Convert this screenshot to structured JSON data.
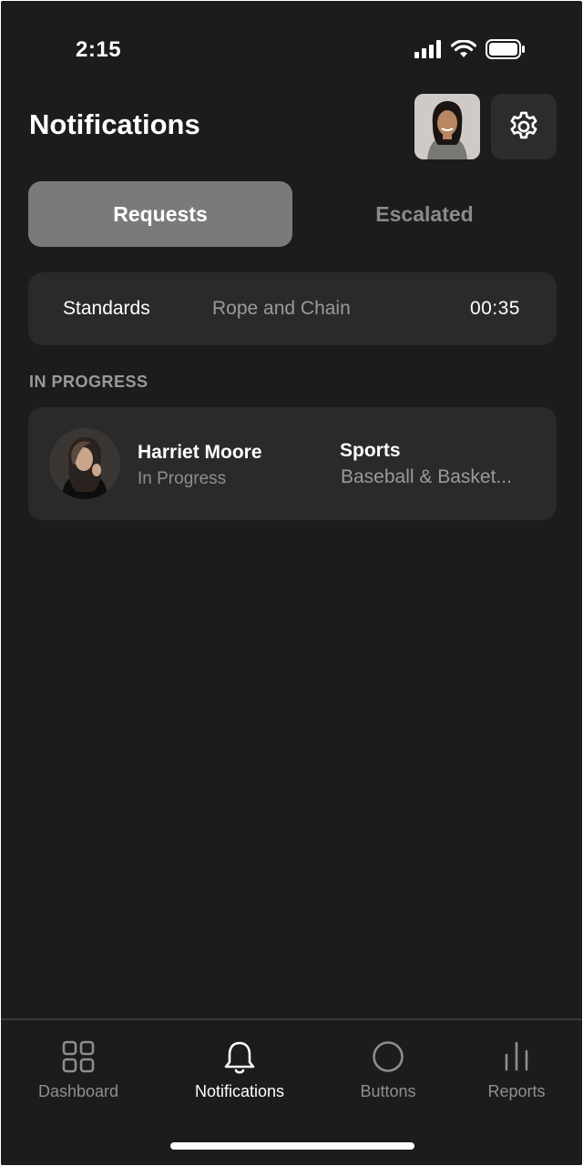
{
  "status_bar": {
    "time": "2:15"
  },
  "header": {
    "title": "Notifications"
  },
  "tabs": [
    {
      "label": "Requests",
      "active": true
    },
    {
      "label": "Escalated",
      "active": false
    }
  ],
  "filter": {
    "category": "Standards",
    "subcategory": "Rope and Chain",
    "timer": "00:35"
  },
  "section": {
    "label": "IN PROGRESS"
  },
  "requests": [
    {
      "name": "Harriet Moore",
      "status": "In Progress",
      "category": "Sports",
      "subcategory": "Baseball & Basket..."
    }
  ],
  "tabbar": [
    {
      "label": "Dashboard",
      "icon": "grid-icon",
      "active": false
    },
    {
      "label": "Notifications",
      "icon": "bell-icon",
      "active": true
    },
    {
      "label": "Buttons",
      "icon": "circle-icon",
      "active": false
    },
    {
      "label": "Reports",
      "icon": "bar-chart-icon",
      "active": false
    }
  ],
  "colors": {
    "background": "#1c1c1c",
    "card": "#2a2a2a",
    "active_tab": "#7a7a7a",
    "muted_text": "#9a9a9a"
  }
}
